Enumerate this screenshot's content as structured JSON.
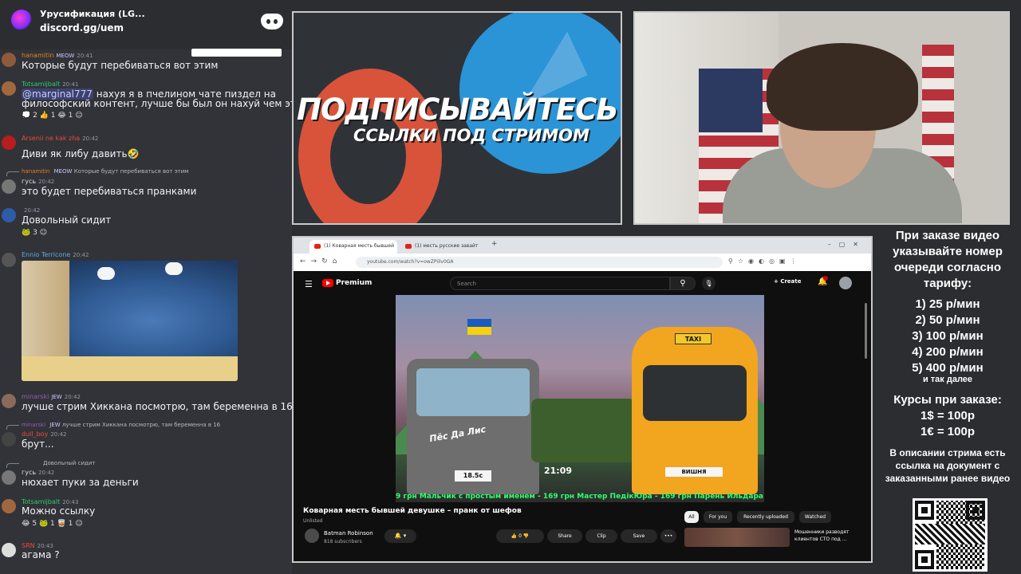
{
  "server": {
    "name": "Урусификация (LG...",
    "link": "discord.gg/uem"
  },
  "messages": [
    {
      "user": "hanamitin",
      "badge": "MEOW",
      "time": "20:41",
      "text": "Которые будут перебиваться вот этим",
      "color": "#e67e22"
    },
    {
      "user": "Totsamijbalt",
      "time": "20:41",
      "mention": "@marginal777",
      "text": " нахуя я в пчелином чате пиздел на",
      "text2": "философский контент, лучше бы был он нахуй чем это",
      "reactions": "💭 2   👍 1   😂 1   ☺",
      "color": "#2ecc71"
    },
    {
      "user": "Arsenii ne kak zha",
      "time": "20:42",
      "text": "Диви як либу давить🤣",
      "color": "#e74c3c"
    },
    {
      "reply_user": "hanamitin",
      "reply_badge": "MEOW",
      "reply_text": "Которые будут перебиваться вот этим",
      "user": "гусь",
      "time": "20:42",
      "text": "это будет перебиваться пранками",
      "color": "#dbdee1"
    },
    {
      "user": "",
      "time": "20:42",
      "text": "Довольный сидит",
      "reactions": "🐸 3   ☺",
      "color": "#dbdee1"
    },
    {
      "user": "Ennio Terricone",
      "time": "20:42",
      "color": "#5dade2"
    },
    {
      "user": "minarski",
      "badge": "JEW",
      "time": "20:42",
      "text": "лучше стрим Хиккана посмотрю, там беременна в 16",
      "color": "#9b59b6"
    },
    {
      "reply_user": "minarski",
      "reply_badge": "JEW",
      "reply_text": "лучше стрим Хиккана посмотрю, там беременна в 16",
      "user": "dull_boy",
      "time": "20:42",
      "text": "брут...",
      "color": "#e74c3c"
    },
    {
      "reply_text": "Довольный сидит",
      "user": "гусь",
      "time": "20:42",
      "text": "нюхает пуки за деньги",
      "color": "#dbdee1"
    },
    {
      "user": "Totsamijbalt",
      "time": "20:43",
      "text": "Можно ссылку",
      "reactions": "😂 5   🐸 1   🥃 1   ☺",
      "color": "#2ecc71"
    },
    {
      "user": "SRN",
      "time": "20:43",
      "text": "агама ?",
      "color": "#e74c3c"
    }
  ],
  "promo": {
    "line1": "ПОДПИСЫВАЙТЕСЬ",
    "line2": "ССЫЛКИ ПОД СТРИМОМ"
  },
  "browser": {
    "tab1": "(1) Коварная месть бывшей",
    "tab2": "(1) месть русские завайт",
    "url": "youtube.com/watch?v=owZPiilv0GA"
  },
  "youtube": {
    "brand": "Premium",
    "search_placeholder": "Search",
    "create_label": "Create",
    "bell_count": "",
    "video_time": "21:09",
    "video_ticker": "9 грн    Мальчик с простым именем - 169 грн    Мастер ПедікЮра - 169 грн    Парень Ильдара -",
    "video_sign": "Пёс Да Лис",
    "truck_plate": "18.5с",
    "van_plate": "ВИШНЯ",
    "taxi_label": "TAXI",
    "title": "Коварная месть бывшей девушке – пранк от шефов",
    "unlisted": "Unlisted",
    "channel": "Batman Robinson",
    "subs": "818 subscribers",
    "like_label": "👍 0   👎",
    "share_label": "Share",
    "clip_label": "Clip",
    "save_label": "Save",
    "more_label": "•••",
    "chips": [
      "All",
      "For you",
      "Recently uploaded",
      "Watched"
    ],
    "rec_title": "Мошенники разводят клиентов СТО под ..."
  },
  "info": {
    "order": "При заказе видео указывайте номер очереди согласно тарифу:",
    "tariffs": [
      "1) 25 р/мин",
      "2) 50 р/мин",
      "3) 100 р/мин",
      "4) 200 р/мин",
      "5) 400 р/мин"
    ],
    "etc": "и так далее",
    "rates_title": "Курсы при заказе:",
    "rate1": "1$ = 100р",
    "rate2": "1€ = 100р",
    "desc": "В описании стрима есть ссылка на документ с заказанными ранее видео"
  }
}
